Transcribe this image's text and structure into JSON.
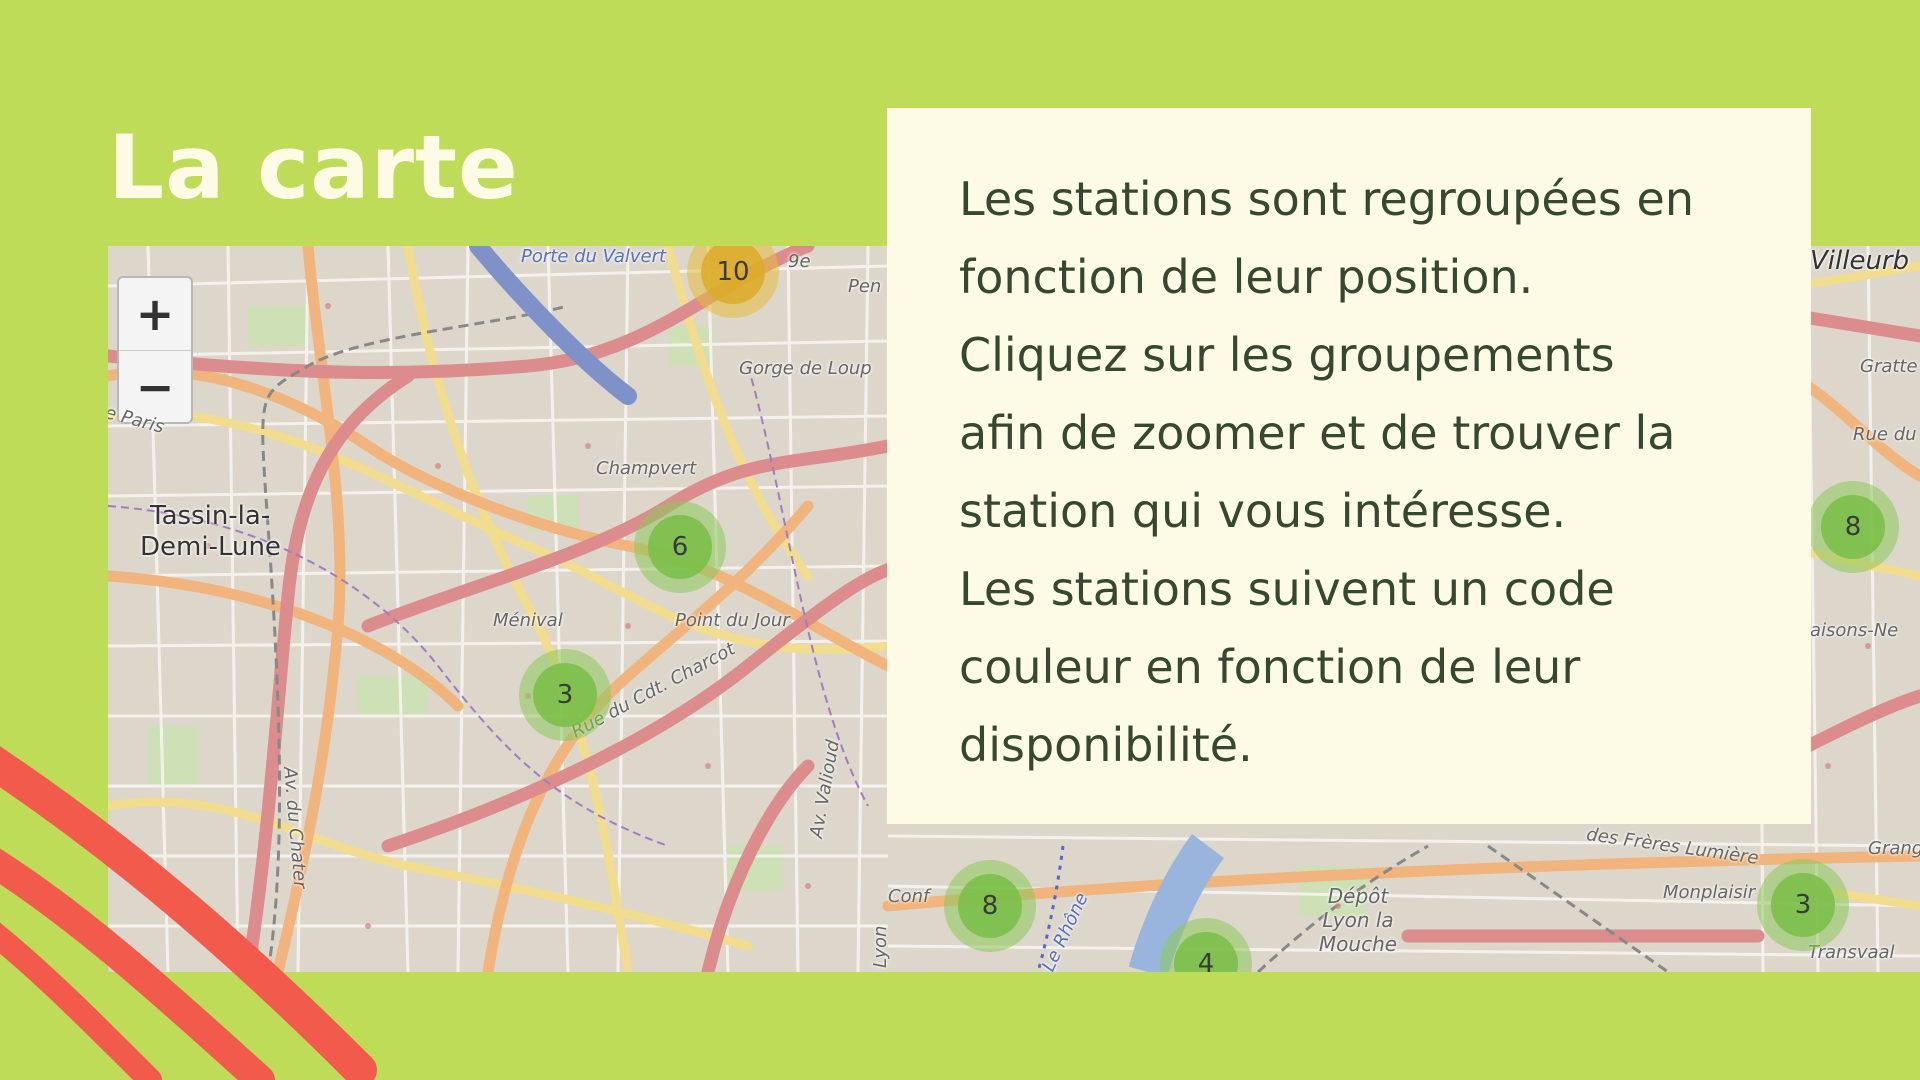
{
  "title": "La carte",
  "info": {
    "lines": [
      "Les stations sont regroupées en",
      "fonction de leur position.",
      "Cliquez sur les groupements",
      "afin de zoomer et de trouver la",
      "station qui vous intéresse.",
      "Les stations suivent un code",
      "couleur en fonction de leur",
      "disponibilité."
    ]
  },
  "map": {
    "zoom_in": "+",
    "zoom_out": "−",
    "clusters": [
      "10",
      "6",
      "3",
      "8",
      "8",
      "3",
      "4"
    ],
    "places": {
      "tassin": "Tassin-la-",
      "demi_lune": "Demi-Lune",
      "champvert": "Champvert",
      "menival": "Ménival",
      "point_du_jour": "Point du Jour",
      "gorge_de_loup": "Gorge de Loup",
      "porte_du_valvert": "Porte du Valvert",
      "rue_charcot": "Rue du Cdt. Charcot",
      "av_du_chater": "Av. du Chater",
      "av_valioud": "Av. Valioud",
      "le_rhone": "Le Rhône",
      "depot_lyon": "Dépôt Lyon la Mouche",
      "freres_lumiere": "des Frères Lumière",
      "monplaisir": "Monplaisir",
      "transvaal": "Transvaal",
      "villeurbanne": "Villeurb",
      "gratte": "Gratte",
      "rue_du": "Rue du",
      "maisons_neuves": "aisons-Ne",
      "grange": "Grange",
      "paris": "e Paris",
      "pen": "Pen",
      "ninth": "9e",
      "conf": "Conf",
      "lyon": "Lyon"
    }
  },
  "colors": {
    "background": "#bedc58",
    "title": "#fdfbe6",
    "infobox": "#fdfbe6",
    "infotext": "#36482f",
    "brush": "#f25a4c",
    "cluster_green": "#78be46",
    "cluster_yellow": "#dcaa28"
  }
}
